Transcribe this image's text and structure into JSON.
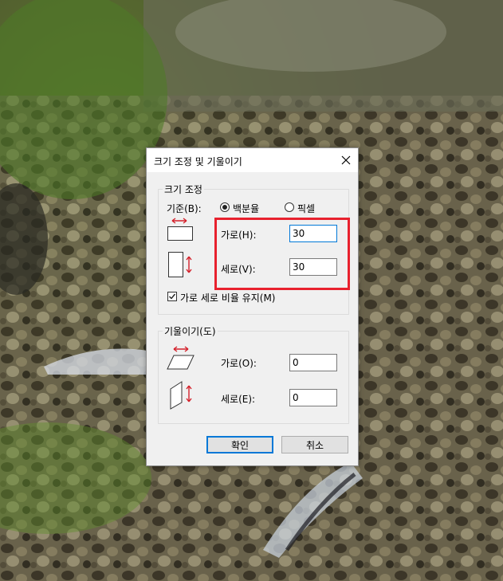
{
  "dialog": {
    "title": "크기 조정 및 기울이기",
    "resize": {
      "group_label": "크기 조정",
      "basis_label": "기준(B):",
      "options": [
        {
          "label": "백분율",
          "selected": true
        },
        {
          "label": "픽셀",
          "selected": false
        }
      ],
      "horizontal_label": "가로(H):",
      "horizontal_value": "30",
      "vertical_label": "세로(V):",
      "vertical_value": "30",
      "keep_ratio_label": "가로 세로 비율 유지(M)",
      "keep_ratio_checked": true
    },
    "skew": {
      "group_label": "기울이기(도)",
      "horizontal_label": "가로(O):",
      "horizontal_value": "0",
      "vertical_label": "세로(E):",
      "vertical_value": "0"
    },
    "buttons": {
      "ok": "확인",
      "cancel": "취소"
    }
  },
  "colors": {
    "highlight_box": "#e8212e",
    "arrow_red": "#d4202a",
    "focus_blue": "#0078d7"
  },
  "icons": {
    "close": "close-icon",
    "resize_horizontal": "resize-horizontal-icon",
    "resize_vertical": "resize-vertical-icon",
    "skew_horizontal": "skew-horizontal-icon",
    "skew_vertical": "skew-vertical-icon",
    "checkbox": "checkmark-icon"
  }
}
